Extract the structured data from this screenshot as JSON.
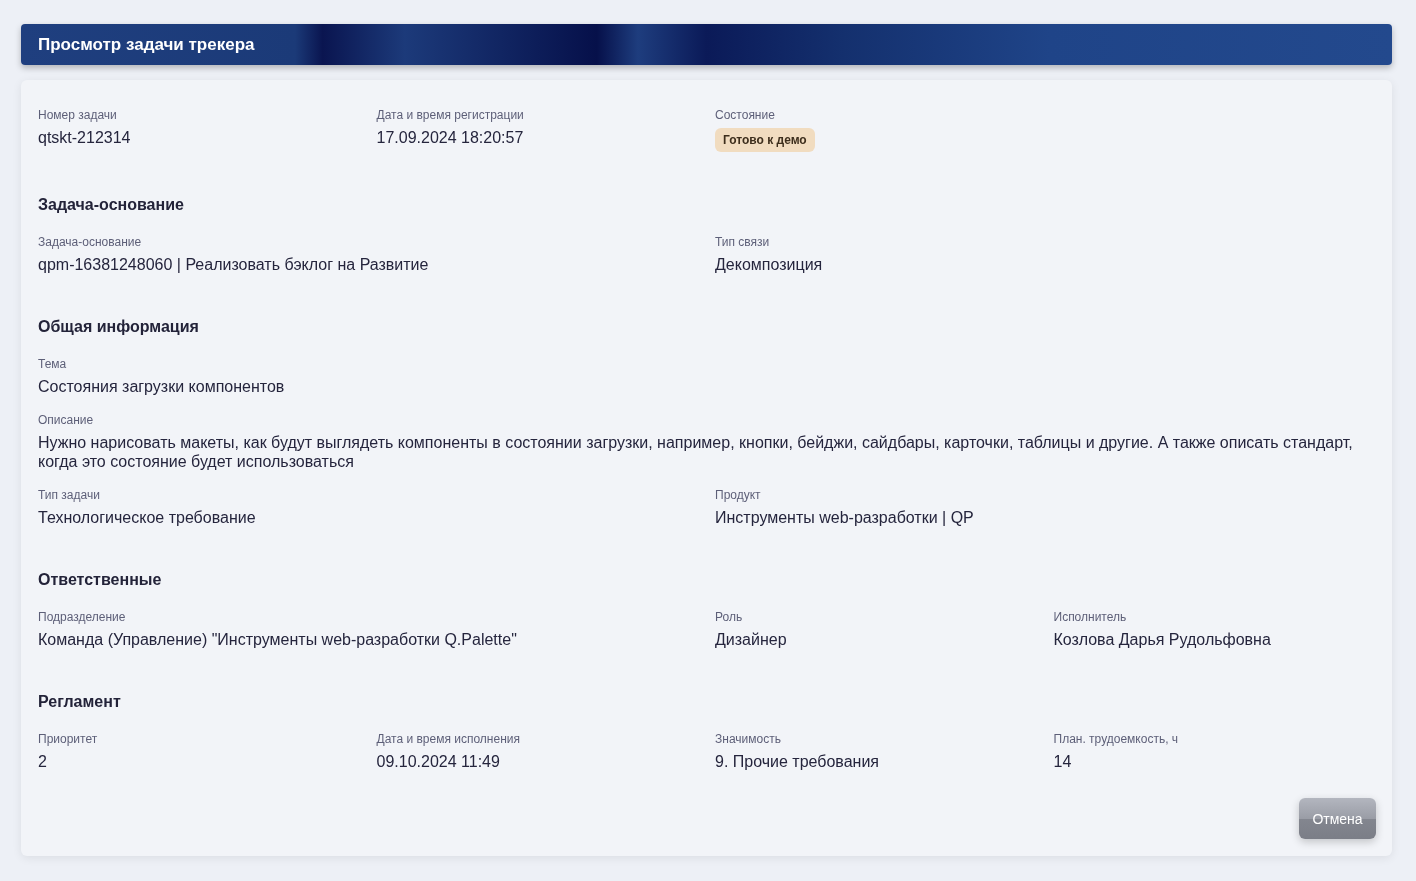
{
  "header": {
    "title": "Просмотр задачи трекера"
  },
  "top_row": {
    "kind": "quarters",
    "fields": [
      {
        "label": "Номер задачи",
        "value": "qtskt-212314",
        "kind": "text"
      },
      {
        "label": "Дата и время регистрации",
        "value": "17.09.2024 18:20:57",
        "kind": "text"
      },
      {
        "label": "Состояние",
        "value": "Готово к демо",
        "kind": "badge"
      }
    ]
  },
  "sections": [
    {
      "title": "Задача-основание",
      "rows": [
        {
          "kind": "halves",
          "fields": [
            {
              "label": "Задача-основание",
              "value": "qpm-16381248060 | Реализовать бэклог на Развитие",
              "kind": "text"
            },
            {
              "label": "Тип связи",
              "value": "Декомпозиция",
              "kind": "text"
            }
          ]
        }
      ]
    },
    {
      "title": "Общая информация",
      "rows": [
        {
          "kind": "full",
          "fields": [
            {
              "label": "Тема",
              "value": "Состояния загрузки компонентов",
              "kind": "text"
            }
          ]
        },
        {
          "kind": "full",
          "fields": [
            {
              "label": "Описание",
              "value": "Нужно нарисовать макеты, как будут выглядеть компоненты в состоянии загрузки, например, кнопки, бейджи, сайдбары, карточки, таблицы и другие. А также описать стандарт, когда это состояние будет использоваться",
              "kind": "text"
            }
          ]
        },
        {
          "kind": "halves",
          "fields": [
            {
              "label": "Тип задачи",
              "value": "Технологическое требование",
              "kind": "text"
            },
            {
              "label": "Продукт",
              "value": "Инструменты web-разработки | QP",
              "kind": "text"
            }
          ]
        }
      ]
    },
    {
      "title": "Ответственные",
      "rows": [
        {
          "kind": "half_quarters",
          "fields": [
            {
              "label": "Подразделение",
              "value": "Команда (Управление) \"Инструменты web-разработки Q.Palette\"",
              "kind": "text"
            },
            {
              "label": "Роль",
              "value": "Дизайнер",
              "kind": "text"
            },
            {
              "label": "Исполнитель",
              "value": "Козлова Дарья Рудольфовна",
              "kind": "text"
            }
          ]
        }
      ]
    },
    {
      "title": "Регламент",
      "rows": [
        {
          "kind": "quarters",
          "fields": [
            {
              "label": "Приоритет",
              "value": "2",
              "kind": "text"
            },
            {
              "label": "Дата и время исполнения",
              "value": "09.10.2024 11:49",
              "kind": "text"
            },
            {
              "label": "Значимость",
              "value": "9. Прочие требования",
              "kind": "text"
            },
            {
              "label": "План. трудоемкость, ч",
              "value": "14",
              "kind": "text"
            }
          ]
        }
      ]
    }
  ],
  "buttons": [
    {
      "label": "Отмена"
    }
  ]
}
